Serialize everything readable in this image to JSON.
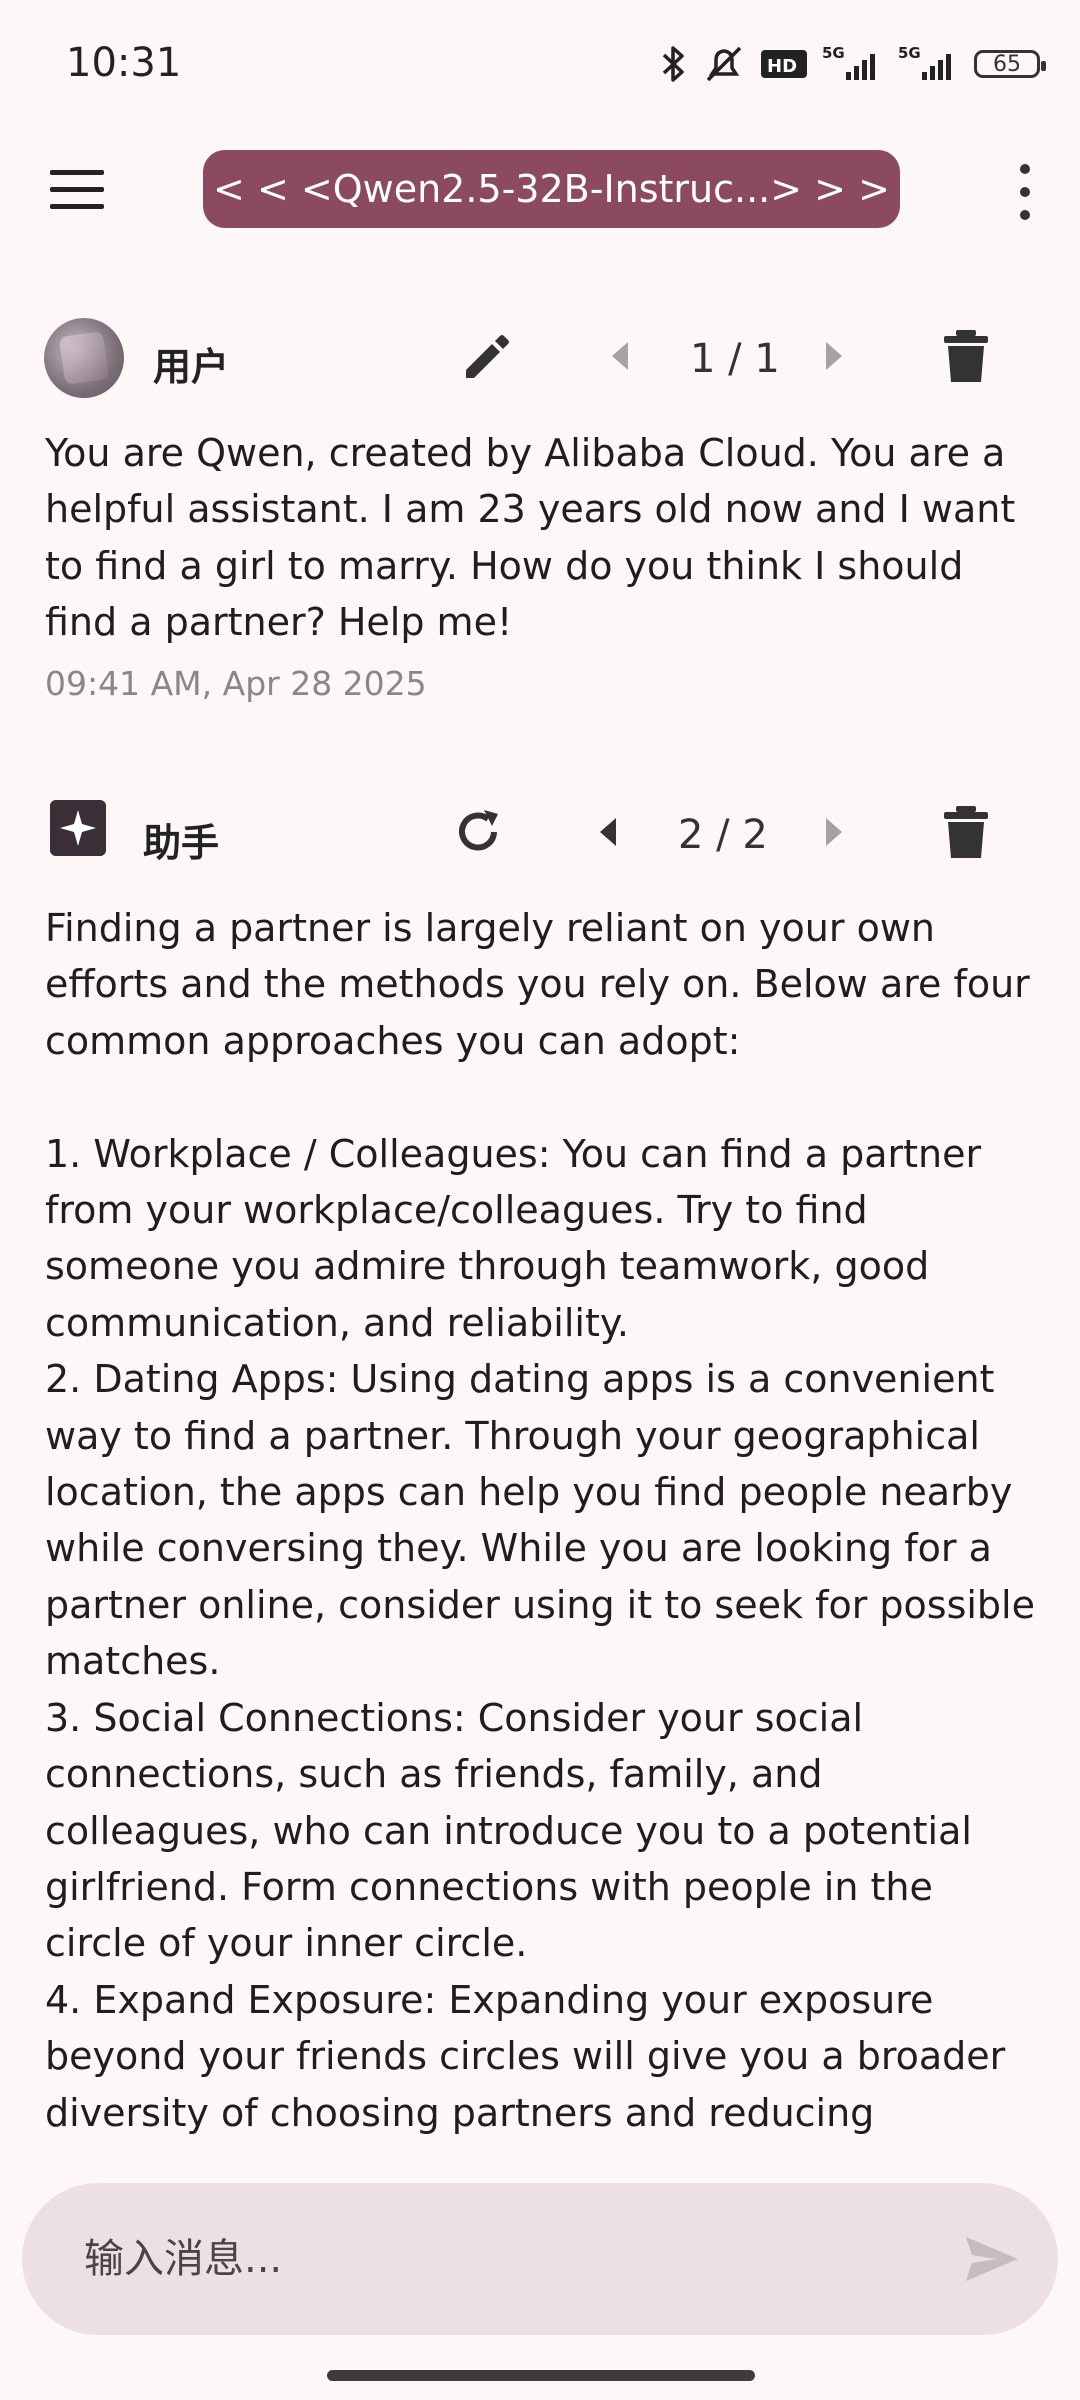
{
  "status_bar": {
    "time": "10:31",
    "icons": [
      "bluetooth-icon",
      "mute-icon",
      "hd-icon",
      "signal-5g-icon",
      "signal-5g-icon"
    ],
    "battery": "65"
  },
  "app_bar": {
    "model": "< < <Qwen2.5-32B-Instruc...> > >"
  },
  "messages": [
    {
      "role": "用户",
      "pager": "1 / 1",
      "text": "You are Qwen, created by Alibaba Cloud. You are a helpful assistant. I am 23 years old now and I want to find a girl to marry. How do you think I should find a partner? Help me!",
      "timestamp": "09:41 AM, Apr 28 2025"
    },
    {
      "role": "助手",
      "pager": "2 / 2",
      "text": "Finding a partner is largely reliant on your own efforts and the methods you rely on. Below are four common approaches you can adopt:\n\n1. Workplace / Colleagues: You can find a partner from your workplace/colleagues. Try to find someone you admire through teamwork, good communication, and reliability.\n2. Dating Apps: Using dating apps is a convenient way to find a partner. Through your geographical location, the apps can help you find people nearby while conversing they. While you are looking for a partner online, consider using it to seek for possible matches.\n3. Social Connections: Consider your social connections, such as friends, family, and colleagues, who can introduce you to a potential girlfriend. Form connections with people in the circle of your inner circle.\n4. Expand Exposure: Expanding your exposure beyond your friends circles will give you a broader diversity of choosing partners and reducing"
    }
  ],
  "input": {
    "placeholder": "输入消息..."
  },
  "colors": {
    "accent": "#8b4a60",
    "background": "#fdf7f7",
    "input_bg": "#ece0e2"
  }
}
